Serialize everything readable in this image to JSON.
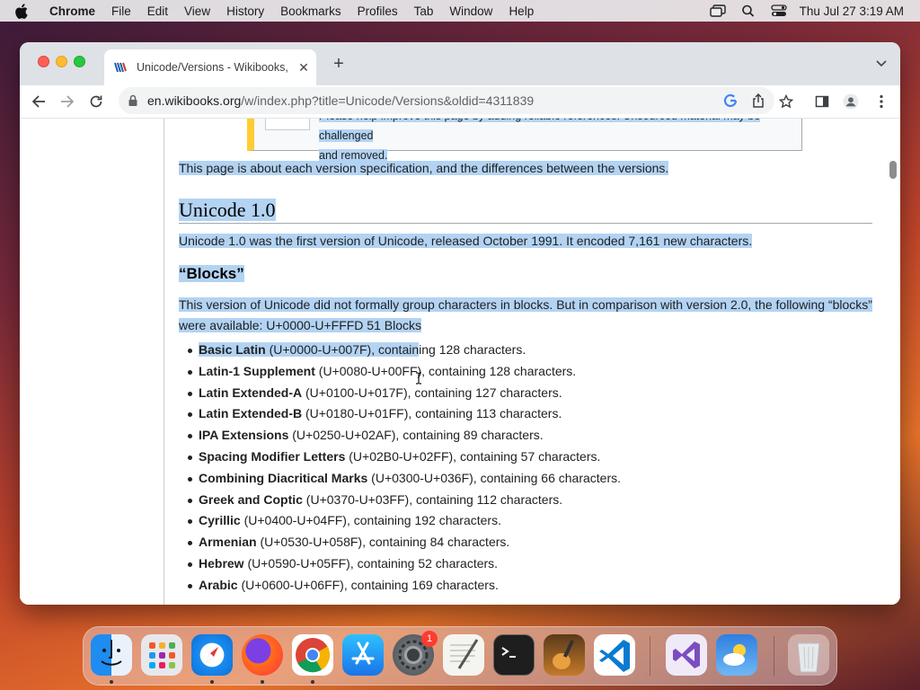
{
  "menubar": {
    "app_name": "Chrome",
    "items": [
      "File",
      "Edit",
      "View",
      "History",
      "Bookmarks",
      "Profiles",
      "Tab",
      "Window",
      "Help"
    ],
    "clock": "Thu Jul 27  3:19 AM"
  },
  "browser": {
    "tab_title": "Unicode/Versions - Wikibooks,",
    "url_host": "en.wikibooks.org",
    "url_path": "/w/index.php?title=Unicode/Versions&oldid=4311839"
  },
  "page": {
    "notice_line1": "Please help improve this page by adding reliable references. Unsourced material may be challenged",
    "notice_line2": "and removed.",
    "intro": "This page is about each version specification, and the differences between the versions.",
    "heading": "Unicode 1.0",
    "unicode10_text": "Unicode 1.0 was the first version of Unicode, released October 1991. It encoded 7,161 new characters.",
    "blocks_heading": "“Blocks”",
    "blocks_line1": "This version of Unicode did not formally group characters in blocks. But in comparison with version 2.0, the following “blocks”",
    "blocks_line2": "were available: U+0000-U+FFFD 51 Blocks",
    "blocks": [
      {
        "name": "Basic Latin",
        "rest": " (U+0000-U+007F), containing 128 characters."
      },
      {
        "name": "Latin-1 Supplement",
        "rest": " (U+0080-U+00FF), containing 128 characters."
      },
      {
        "name": "Latin Extended-A",
        "rest": " (U+0100-U+017F), containing 127 characters."
      },
      {
        "name": "Latin Extended-B",
        "rest": " (U+0180-U+01FF), containing 113 characters."
      },
      {
        "name": "IPA Extensions",
        "rest": " (U+0250-U+02AF), containing 89 characters."
      },
      {
        "name": "Spacing Modifier Letters",
        "rest": " (U+02B0-U+02FF), containing 57 characters."
      },
      {
        "name": "Combining Diacritical Marks",
        "rest": " (U+0300-U+036F), containing 66 characters."
      },
      {
        "name": "Greek and Coptic",
        "rest": " (U+0370-U+03FF), containing 112 characters."
      },
      {
        "name": "Cyrillic",
        "rest": " (U+0400-U+04FF), containing 192 characters."
      },
      {
        "name": "Armenian",
        "rest": " (U+0530-U+058F), containing 84 characters."
      },
      {
        "name": "Hebrew",
        "rest": " (U+0590-U+05FF), containing 52 characters."
      },
      {
        "name": "Arabic",
        "rest": " (U+0600-U+06FF), containing 169 characters."
      }
    ]
  },
  "dock": {
    "settings_badge": "1",
    "apps": [
      "finder",
      "launchpad",
      "safari",
      "firefox",
      "chrome",
      "app-store",
      "system-settings",
      "textedit",
      "terminal",
      "garageband",
      "vscode",
      "visual-studio",
      "weather",
      "trash"
    ]
  },
  "colors": {
    "selection": "#b3d3f3",
    "accent": "#1a73e8"
  }
}
